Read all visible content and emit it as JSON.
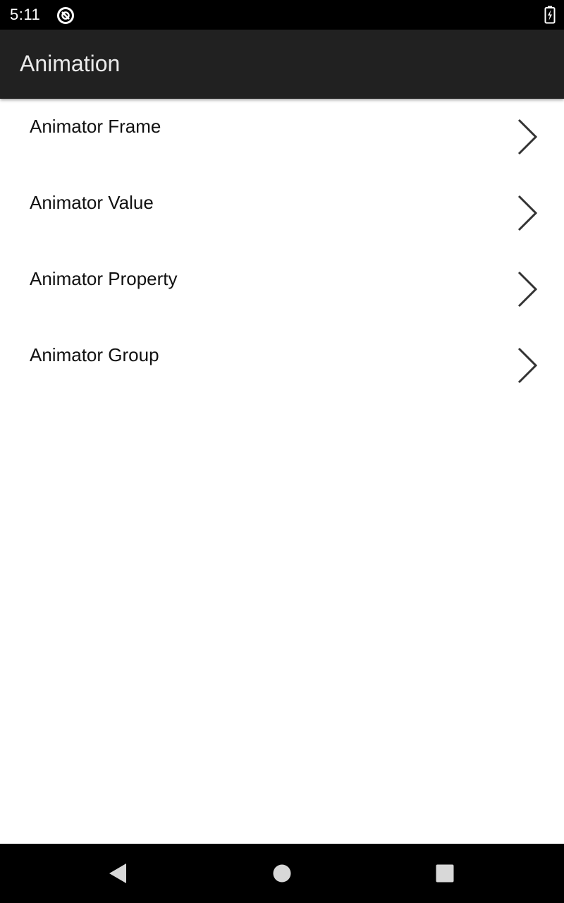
{
  "status_bar": {
    "time": "5:11",
    "app_icon": "at-sign-icon",
    "battery_icon": "battery-charging-icon"
  },
  "app_bar": {
    "title": "Animation"
  },
  "list": {
    "items": [
      {
        "label": "Animator Frame",
        "icon": "chevron-right-icon"
      },
      {
        "label": "Animator Value",
        "icon": "chevron-right-icon"
      },
      {
        "label": "Animator Property",
        "icon": "chevron-right-icon"
      },
      {
        "label": "Animator Group",
        "icon": "chevron-right-icon"
      }
    ]
  },
  "nav_bar": {
    "back_icon": "back-triangle-icon",
    "home_icon": "home-circle-icon",
    "recents_icon": "recents-square-icon"
  },
  "colors": {
    "status_bar_bg": "#000000",
    "app_bar_bg": "#212121",
    "app_title": "#eaeaea",
    "list_text": "#111111",
    "chevron": "#333333",
    "nav_icon": "#d8d8d8"
  }
}
